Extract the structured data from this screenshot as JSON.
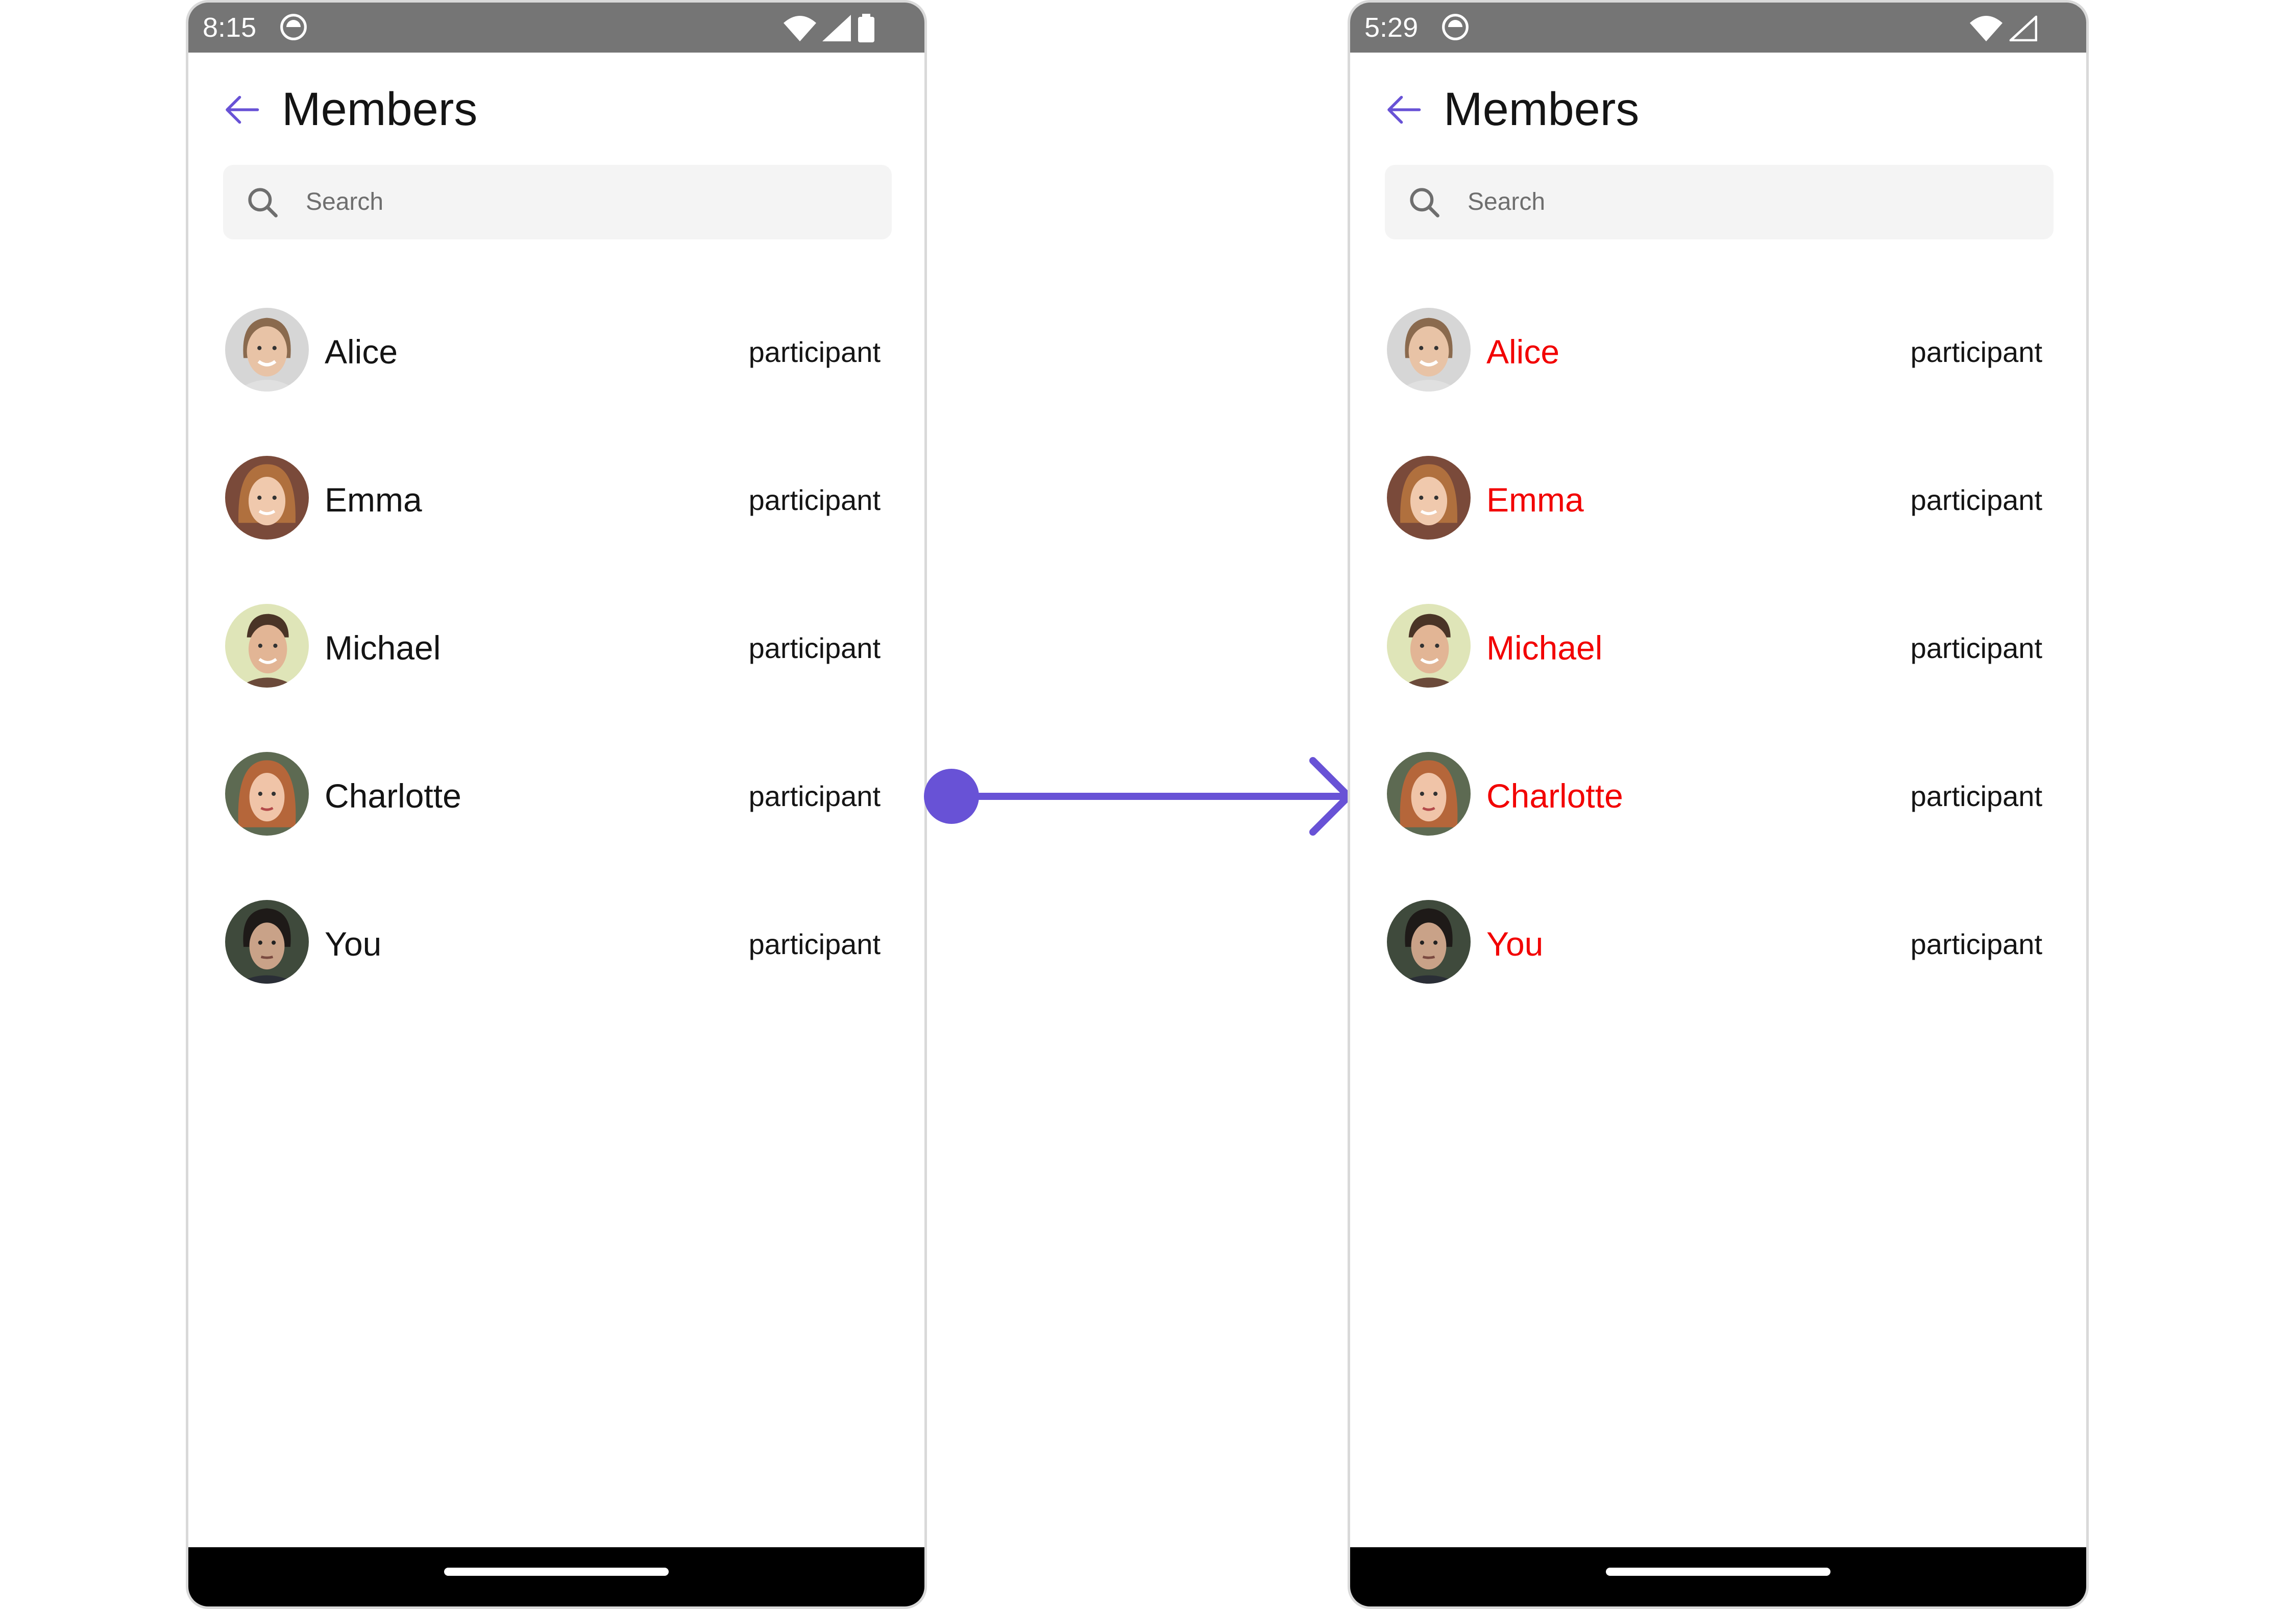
{
  "before": {
    "status": {
      "time": "8:15"
    },
    "header": {
      "title": "Members"
    },
    "search": {
      "placeholder": "Search"
    },
    "members": [
      {
        "name": "Alice",
        "role": "participant"
      },
      {
        "name": "Emma",
        "role": "participant"
      },
      {
        "name": "Michael",
        "role": "participant"
      },
      {
        "name": "Charlotte",
        "role": "participant"
      },
      {
        "name": "You",
        "role": "participant"
      }
    ]
  },
  "after": {
    "status": {
      "time": "5:29"
    },
    "header": {
      "title": "Members"
    },
    "search": {
      "placeholder": "Search"
    },
    "members": [
      {
        "name": "Alice",
        "role": "participant"
      },
      {
        "name": "Emma",
        "role": "participant"
      },
      {
        "name": "Michael",
        "role": "participant"
      },
      {
        "name": "Charlotte",
        "role": "participant"
      },
      {
        "name": "You",
        "role": "participant"
      }
    ]
  },
  "icons": {
    "back": "arrow-left-icon",
    "search": "search-icon",
    "wifi": "wifi-icon",
    "signal": "cell-signal-icon",
    "battery": "battery-icon",
    "app": "app-notification-icon",
    "transition": "arrow-right-icon"
  },
  "colors": {
    "accent": "#6852d6",
    "member_name_highlight": "#f20000",
    "status_bar": "#757575",
    "search_background": "#f4f4f4",
    "nav_bar": "#000000"
  }
}
